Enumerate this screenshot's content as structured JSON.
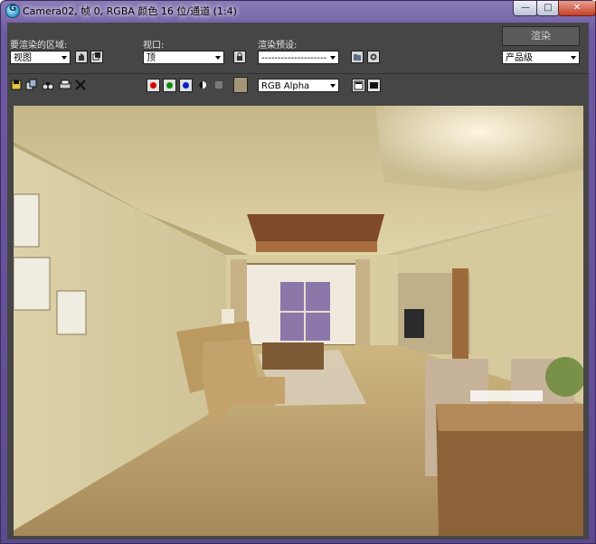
{
  "window": {
    "title": "Camera02, 帧 0, RGBA 颜色 16 位/通道 (1:4)",
    "controls": {
      "minimize": "—",
      "maximize": "□",
      "close": "✕"
    }
  },
  "render_area": {
    "label": "要渲染的区域:",
    "value": "视图"
  },
  "viewport": {
    "label": "视口:",
    "value": "顶"
  },
  "render_preset": {
    "label": "渲染预设:",
    "value": "--------------------"
  },
  "render_button": {
    "label": "渲染"
  },
  "production": {
    "value": "产品级"
  },
  "channel_select": {
    "value": "RGB Alpha"
  },
  "colors": {
    "red_channel": "#d40000",
    "green_channel": "#0b8f0b",
    "blue_channel": "#0a1fc4",
    "swatch": "#a39678"
  },
  "icons": {
    "pan": "hand-icon",
    "copy_window": "clone-window-icon",
    "lock": "lock-icon",
    "preset_load": "folder-icon",
    "preset_settings": "gear-icon",
    "save": "floppy-disk-icon",
    "copy_image": "copy-image-icon",
    "clone_frame": "binoculars-icon",
    "print": "printer-icon",
    "clear": "close-icon",
    "monochrome": "half-circle-icon",
    "clear_channel": "gray-square-icon",
    "toggle_ui": "panel-icon",
    "toggle_overlay": "black-rect-icon"
  }
}
